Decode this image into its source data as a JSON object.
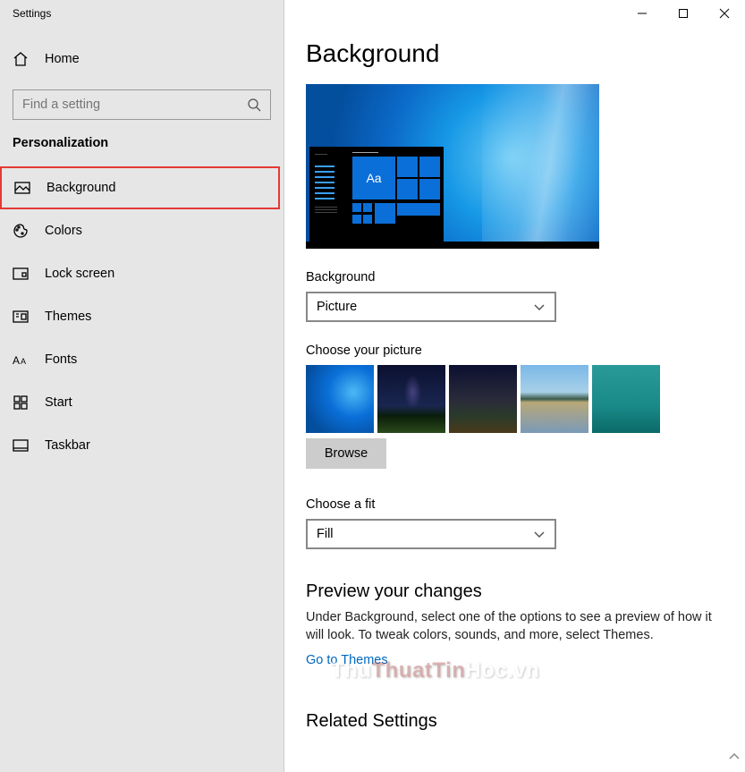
{
  "window": {
    "title": "Settings"
  },
  "sidebar": {
    "home": "Home",
    "search": {
      "placeholder": "Find a setting"
    },
    "category": "Personalization",
    "items": [
      {
        "label": "Background",
        "icon": "picture-icon",
        "selected": true
      },
      {
        "label": "Colors",
        "icon": "palette-icon",
        "selected": false
      },
      {
        "label": "Lock screen",
        "icon": "lockscreen-icon",
        "selected": false
      },
      {
        "label": "Themes",
        "icon": "themes-icon",
        "selected": false
      },
      {
        "label": "Fonts",
        "icon": "fonts-icon",
        "selected": false
      },
      {
        "label": "Start",
        "icon": "start-icon",
        "selected": false
      },
      {
        "label": "Taskbar",
        "icon": "taskbar-icon",
        "selected": false
      }
    ]
  },
  "main": {
    "title": "Background",
    "preview": {
      "sample_text": "Aa"
    },
    "background_label": "Background",
    "background_dropdown": {
      "value": "Picture"
    },
    "choose_picture_label": "Choose your picture",
    "browse_label": "Browse",
    "fit_label": "Choose a fit",
    "fit_dropdown": {
      "value": "Fill"
    },
    "preview_heading": "Preview your changes",
    "preview_desc": "Under Background, select one of the options to see a preview of how it will look. To tweak colors, sounds, and more, select Themes.",
    "themes_link": "Go to Themes",
    "related_heading": "Related Settings"
  },
  "watermark": {
    "text_left": "Thu",
    "text_mid": "ThuatTin",
    "text_right": "Hoc.vn"
  }
}
